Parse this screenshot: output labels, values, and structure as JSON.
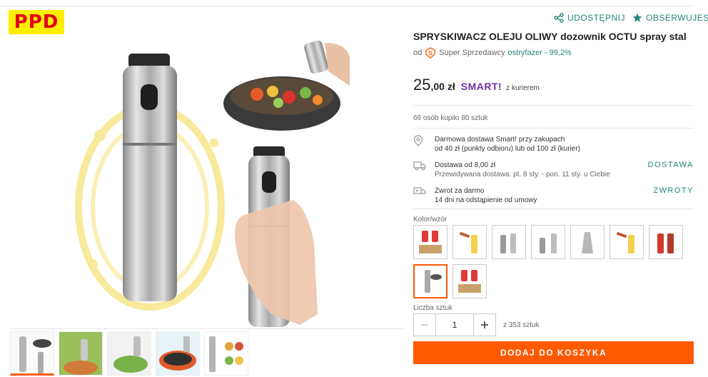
{
  "logo": {
    "text": "PPD"
  },
  "actions": {
    "share": "UDOSTĘPNIJ",
    "watch": "OBSERWUJESZ"
  },
  "product": {
    "title": "SPRYSKIWACZ OLEJU OLIWY dozownik OCTU spray stal",
    "seller_prefix": "od",
    "seller_badge": "Super Sprzedawcy",
    "seller_name": "ostryfazer - 99,2%"
  },
  "price": {
    "main": "25",
    "decimals": ",00 zł",
    "smart": "SMART!",
    "courier": "z kurierem"
  },
  "sold": "66 osób kupiło 80 sztuk",
  "shipping": [
    {
      "icon": "location-icon",
      "line1": "Darmowa dostawa Smart! przy zakupach",
      "line2": "od 40 zł (punkty odbioru) lub od 100 zł (kurier)",
      "link": ""
    },
    {
      "icon": "truck-icon",
      "line1": "Dostawa od 8,00 zł",
      "line2": "Przewidywana dostawa: pt. 8 sty. - pon. 11 sty. u Ciebie",
      "link": "DOSTAWA"
    },
    {
      "icon": "return-icon",
      "line1": "Zwrot za darmo",
      "line2": "14 dni na odstąpienie od umowy",
      "link": "ZWROTY"
    }
  ],
  "variants": {
    "label": "Kolor/wzór",
    "count": 9,
    "selected": 8
  },
  "quantity": {
    "label": "Liczba sztuk",
    "value": "1",
    "of": "z 353 sztuk"
  },
  "cart": {
    "label": "DODAJ DO KOSZYKA"
  },
  "colors": {
    "accent": "#ff5a00",
    "link": "#22867a",
    "smart": "#6b2fa3",
    "logo_bg": "#ffee00",
    "logo_fg": "#e4001b"
  }
}
